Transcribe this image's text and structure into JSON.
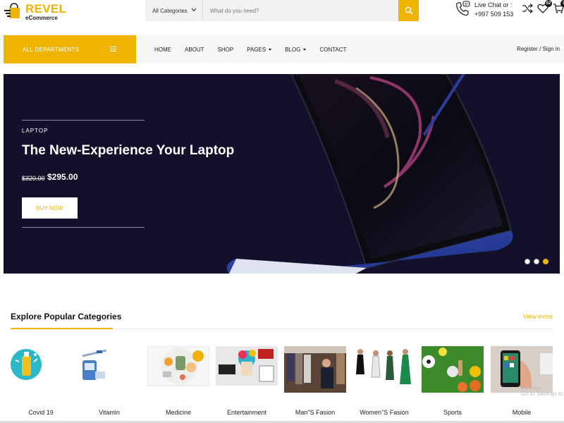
{
  "brand": {
    "name": "REVEL",
    "tagline": "eCommerce",
    "accent_color": "#f0b400"
  },
  "search": {
    "category": "All Categories",
    "placeholder": "What do you need?",
    "button_icon": "search-icon"
  },
  "contact": {
    "label": "Live Chat or :",
    "phone": "+997 509 153"
  },
  "header_icons": [
    {
      "name": "shuffle-icon",
      "badge": ""
    },
    {
      "name": "heart-icon",
      "badge": "02"
    },
    {
      "name": "cart-icon",
      "badge": "0"
    }
  ],
  "nav": {
    "departments": "ALL DEPARTMENTS",
    "items": [
      "HOME",
      "ABOUT",
      "SHOP",
      "PAGES",
      "BLOG",
      "CONTACT"
    ],
    "account": "Register / Sign in"
  },
  "hero": {
    "kicker": "LAPTOP",
    "title": "The New-Experience Your Laptop",
    "old_price": "$320.00",
    "new_price": "$295.00",
    "button": "BUY NOW",
    "slides": 3,
    "active_slide": 3
  },
  "categories": {
    "title": "Explore Popular Categories",
    "view_more": "View more",
    "items": [
      "Covid 19",
      "Vitamin",
      "Medicine",
      "Entertainment",
      "Man\"S Fasion",
      "Women\"S Fasion",
      "Sports",
      "Mobile"
    ]
  },
  "watermark": {
    "line1": "Activate Windows",
    "line2": "Go to Settings to"
  }
}
